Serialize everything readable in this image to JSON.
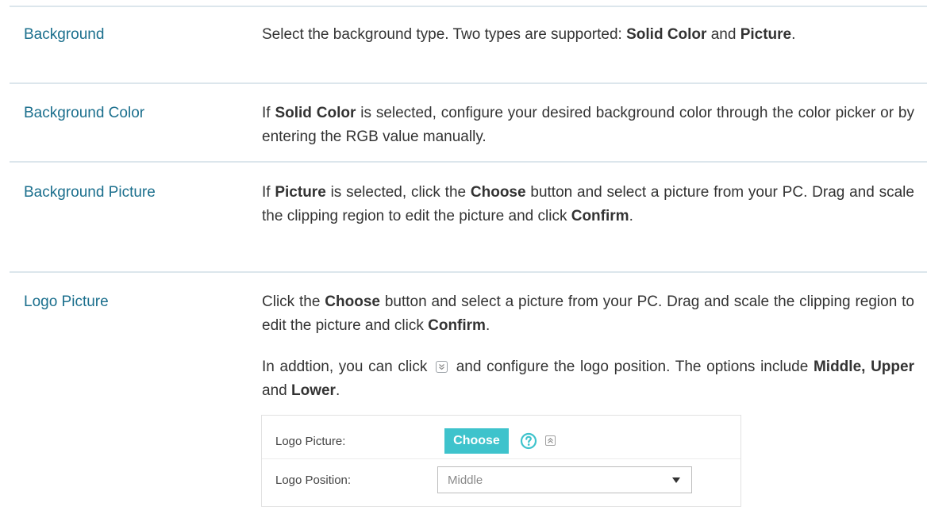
{
  "rows": [
    {
      "term": "Background",
      "desc": [
        {
          "t": "Select the background type. Two types are supported: "
        },
        {
          "t": "Solid Color",
          "b": true
        },
        {
          "t": " and "
        },
        {
          "t": "Picture",
          "b": true
        },
        {
          "t": "."
        }
      ]
    },
    {
      "term": "Background Color",
      "desc": [
        {
          "t": "If "
        },
        {
          "t": "Solid Color",
          "b": true
        },
        {
          "t": " is selected, configure your desired background color through the color picker or by entering the RGB value manually."
        }
      ]
    },
    {
      "term": "Background Picture",
      "desc": [
        {
          "t": "If "
        },
        {
          "t": "Picture",
          "b": true
        },
        {
          "t": " is selected, click the "
        },
        {
          "t": "Choose",
          "b": true
        },
        {
          "t": " button and select a picture from your PC. Drag and scale the clipping region to edit the picture and click "
        },
        {
          "t": "Confirm",
          "b": true
        },
        {
          "t": "."
        }
      ]
    },
    {
      "term": "Logo Picture",
      "desc": [
        {
          "t": "Click the "
        },
        {
          "t": "Choose",
          "b": true
        },
        {
          "t": " button and select a picture from your PC. Drag and scale the clipping region to edit the picture and click "
        },
        {
          "t": "Confirm",
          "b": true
        },
        {
          "t": "."
        }
      ],
      "desc2": [
        {
          "t": "In addtion, you can click "
        },
        {
          "icon": "expand-down-icon"
        },
        {
          "t": " and configure the logo position. The options include "
        },
        {
          "t": "Middle, Upper",
          "b": true
        },
        {
          "t": " and "
        },
        {
          "t": "Lower",
          "b": true
        },
        {
          "t": "."
        }
      ]
    }
  ],
  "panel": {
    "logo_picture_label": "Logo Picture:",
    "choose_button": "Choose",
    "help_icon": "question-circle-icon",
    "collapse_icon": "collapse-up-icon",
    "logo_position_label": "Logo Position:",
    "logo_position_value": "Middle"
  },
  "colors": {
    "term": "#1b6f8d",
    "separator": "#dce6ec",
    "button": "#3ec3cc"
  }
}
